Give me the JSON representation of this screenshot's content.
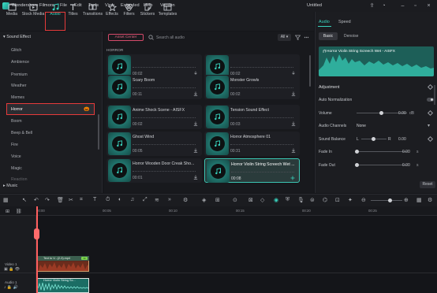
{
  "app": {
    "name": "Wondershare Filmora",
    "menus": [
      "File",
      "Edit",
      "Tools",
      "View",
      "Extended",
      "Help",
      "Version"
    ],
    "project_title": "Untitled"
  },
  "toolbar": {
    "tabs": [
      "Media",
      "Stock Media",
      "Audio",
      "Titles",
      "Transitions",
      "Effects",
      "Filters",
      "Stickers",
      "Templates"
    ],
    "active": "Audio"
  },
  "sidebar": {
    "header": "Sound Effect",
    "items": [
      "Glitch",
      "Ambience",
      "Premium",
      "Weather",
      "Memes",
      "Horror",
      "Boom",
      "Beep & Bell",
      "Fire",
      "Voice",
      "Magic",
      "Reaction"
    ],
    "selected": "Horror",
    "footer": "Music"
  },
  "library": {
    "asset_center": "Asset Center",
    "search_placeholder": "Search all audio",
    "filter_all": "All",
    "section": "HORROR",
    "cards": [
      {
        "title": "",
        "duration": "00:02"
      },
      {
        "title": "",
        "duration": "00:02"
      },
      {
        "title": "Scary Boom",
        "duration": "00:11"
      },
      {
        "title": "Monster Growls",
        "duration": "00:02"
      },
      {
        "title": "Anime Shock Scene - AISFX",
        "duration": "00:02"
      },
      {
        "title": "Tension Sound Effect",
        "duration": "00:03"
      },
      {
        "title": "Ghost Wind",
        "duration": "00:05"
      },
      {
        "title": "Horror Atmosphere 01",
        "duration": "00:31"
      },
      {
        "title": "Horror Wooden Door Creak Sho...",
        "duration": "00:01"
      },
      {
        "title": "Horror Violin String Screech Wet ...",
        "duration": "00:08"
      }
    ]
  },
  "right_panel": {
    "tabs": [
      "Audio",
      "Speed"
    ],
    "subtabs": [
      "Basic",
      "Denoise"
    ],
    "waveform_title": "Horror Violin String Screech Wet - AISFX",
    "adjustment": "Adjustment",
    "auto_normalization": "Auto Normalization",
    "volume_label": "Volume",
    "volume_value": "0.00",
    "volume_unit": "dB",
    "channels_label": "Audio Channels",
    "channels_value": "None",
    "balance_label": "Sound Balance",
    "balance_left": "L",
    "balance_value": "0.00",
    "balance_right": "R",
    "fade_in_label": "Fade In",
    "fade_in_value": "0.00",
    "fade_out_label": "Fade Out",
    "fade_out_value": "0.00",
    "fade_unit": "s",
    "reset": "Reset",
    "accent_color": "#39d3be"
  },
  "timeline": {
    "ticks": [
      "00:00",
      "00:05",
      "00:10",
      "00:15",
      "00:20",
      "00:25"
    ],
    "tracks": [
      "Video 1",
      "Audio 1"
    ],
    "video_clip": "Text to V...(2-3).mp4",
    "video_badge": "AI",
    "audio_clip": "Horror Violin String Sc..."
  }
}
